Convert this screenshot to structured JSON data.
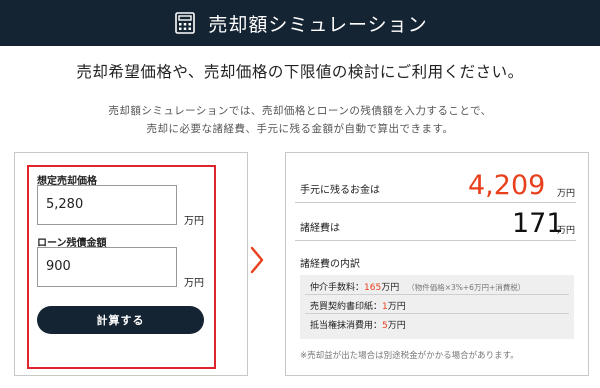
{
  "header": {
    "title": "売却額シミュレーション",
    "icon": "calculator-icon"
  },
  "lead": "売却希望価格や、売却価格の下限値の検討にご利用ください。",
  "description": {
    "line1": "売却額シミュレーションでは、売却価格とローンの残債額を入力することで、",
    "line2": "売却に必要な諸経費、手元に残る金額が自動で算出できます。"
  },
  "form": {
    "price_label": "想定売却価格",
    "price_value": "5,280",
    "price_unit": "万円",
    "loan_label": "ローン残債金額",
    "loan_value": "900",
    "loan_unit": "万円",
    "button_label": "計算する"
  },
  "result": {
    "remaining_label": "手元に残るお金は",
    "remaining_value": "4,209",
    "remaining_unit": "万円",
    "expenses_label": "諸経費は",
    "expenses_value": "171",
    "expenses_unit": "万円",
    "breakdown_title": "諸経費の内訳",
    "breakdown": [
      {
        "label": "仲介手数料：",
        "value": "165",
        "unit": "万円",
        "note": "（物件価格×3%+6万円+消費税）"
      },
      {
        "label": "売買契約書印紙：",
        "value": "1",
        "unit": "万円",
        "note": ""
      },
      {
        "label": "抵当権抹消費用：",
        "value": "5",
        "unit": "万円",
        "note": ""
      }
    ],
    "footnote": "※売却益が出た場合は別途税金がかかる場合があります。"
  },
  "colors": {
    "navy": "#152433",
    "accent": "#e8401c",
    "highlight_border": "#e0242d"
  }
}
